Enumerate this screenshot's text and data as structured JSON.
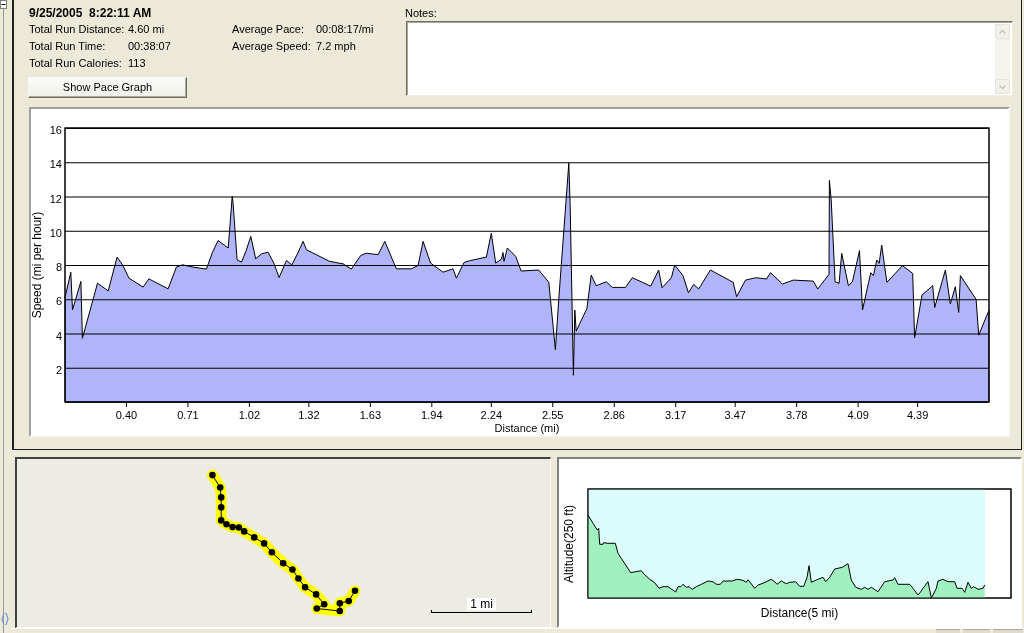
{
  "run_summary": {
    "date_time": "9/25/2005  8:22:11 AM",
    "totals": [
      {
        "label": "Total Run Distance:",
        "value": "4.60 mi"
      },
      {
        "label": "Total Run Time:",
        "value": "00:38:07"
      },
      {
        "label": "Total Run Calories:",
        "value": "113"
      }
    ],
    "averages": [
      {
        "label": "Average Pace:",
        "value": "00:08:17/mi"
      },
      {
        "label": "Average Speed:",
        "value": "7.2 mph"
      }
    ],
    "button": "Show Pace Graph"
  },
  "notes": {
    "label": "Notes:"
  },
  "speed_chart": {
    "chart_data": {
      "type": "area",
      "grid": true,
      "xlabel": "Distance (mi)",
      "ylabel": "Speed (mi per hour)",
      "x": [
        0.091,
        0.119,
        0.128,
        0.17,
        0.178,
        0.254,
        0.308,
        0.353,
        0.38,
        0.413,
        0.484,
        0.513,
        0.61,
        0.652,
        0.682,
        0.736,
        0.77,
        0.803,
        0.834,
        0.862,
        0.913,
        0.933,
        0.938,
        0.958,
        0.98,
        1.002,
        1.027,
        1.052,
        1.081,
        1.114,
        1.143,
        1.17,
        1.207,
        1.234,
        1.262,
        1.291,
        1.308,
        1.425,
        1.492,
        1.534,
        1.582,
        1.61,
        1.669,
        1.703,
        1.761,
        1.837,
        1.871,
        1.896,
        1.934,
        1.997,
        2.047,
        2.064,
        2.103,
        2.135,
        2.215,
        2.24,
        2.262,
        2.291,
        2.299,
        2.304,
        2.321,
        2.363,
        2.39,
        2.479,
        2.53,
        2.563,
        2.58,
        2.631,
        2.638,
        2.654,
        2.661,
        2.668,
        2.722,
        2.744,
        2.769,
        2.82,
        2.85,
        2.917,
        2.951,
        3.044,
        3.084,
        3.101,
        3.148,
        3.165,
        3.207,
        3.234,
        3.261,
        3.286,
        3.345,
        3.46,
        3.477,
        3.522,
        3.574,
        3.628,
        3.648,
        3.708,
        3.763,
        3.864,
        3.886,
        3.943,
        3.945,
        3.954,
        3.974,
        3.994,
        4.007,
        4.041,
        4.061,
        4.097,
        4.112,
        4.142,
        4.154,
        4.167,
        4.184,
        4.196,
        4.209,
        4.235,
        4.314,
        4.365,
        4.375,
        4.412,
        4.466,
        4.476,
        4.53,
        4.555,
        4.58,
        4.597,
        4.606,
        4.685,
        4.698,
        4.749
      ],
      "values": [
        6.16,
        7.58,
        5.38,
        7.04,
        3.72,
        6.94,
        6.49,
        8.46,
        8.01,
        7.23,
        6.71,
        7.19,
        6.61,
        7.88,
        8.01,
        7.88,
        7.82,
        7.76,
        8.75,
        9.43,
        8.99,
        12.0,
        11.6,
        8.3,
        8.17,
        8.79,
        9.67,
        8.36,
        8.65,
        8.75,
        8.11,
        7.27,
        8.26,
        8.01,
        8.64,
        9.38,
        8.89,
        8.21,
        8.07,
        7.76,
        8.56,
        8.69,
        8.6,
        9.38,
        7.78,
        7.78,
        7.97,
        9.38,
        8.11,
        7.58,
        7.78,
        7.23,
        8.15,
        8.26,
        8.46,
        9.86,
        8.11,
        8.34,
        8.73,
        8.21,
        8.99,
        8.5,
        7.65,
        7.71,
        6.99,
        3.06,
        5.95,
        13.95,
        11.41,
        1.56,
        5.37,
        4.14,
        5.46,
        7.41,
        6.79,
        7.02,
        6.69,
        6.69,
        7.26,
        6.77,
        7.71,
        6.67,
        7.26,
        8.0,
        7.38,
        6.38,
        6.87,
        6.6,
        7.71,
        6.99,
        6.15,
        7.12,
        7.26,
        7.18,
        7.55,
        6.89,
        7.12,
        7.06,
        6.6,
        7.45,
        12.94,
        11.8,
        7.02,
        6.93,
        8.68,
        6.79,
        7.02,
        8.84,
        5.37,
        6.93,
        7.55,
        7.38,
        8.29,
        8.1,
        9.17,
        6.99,
        7.96,
        7.51,
        3.75,
        6.24,
        6.79,
        5.52,
        7.71,
        5.72,
        6.73,
        5.23,
        7.38,
        5.99,
        3.9,
        5.33
      ],
      "xlim": [
        0.09,
        4.75
      ],
      "ylim": [
        0,
        16
      ],
      "xticks": [
        {
          "value": 0.4,
          "label": "0.40"
        },
        {
          "value": 0.71,
          "label": "0.71"
        },
        {
          "value": 1.02,
          "label": "1.02"
        },
        {
          "value": 1.32,
          "label": "1.32"
        },
        {
          "value": 1.63,
          "label": "1.63"
        },
        {
          "value": 1.94,
          "label": "1.94"
        },
        {
          "value": 2.24,
          "label": "2.24"
        },
        {
          "value": 2.55,
          "label": "2.55"
        },
        {
          "value": 2.86,
          "label": "2.86"
        },
        {
          "value": 3.17,
          "label": "3.17"
        },
        {
          "value": 3.47,
          "label": "3.47"
        },
        {
          "value": 3.78,
          "label": "3.78"
        },
        {
          "value": 4.09,
          "label": "4.09"
        },
        {
          "value": 4.39,
          "label": "4.39"
        }
      ],
      "yticks": [
        2,
        4,
        6,
        8,
        10,
        12,
        14,
        16
      ]
    }
  },
  "route_map": {
    "scale_label": "1 mi"
  },
  "altitude_chart": {
    "ylabel": "Altitude(250 ft)",
    "xlabel": "Distance(5 mi)"
  }
}
